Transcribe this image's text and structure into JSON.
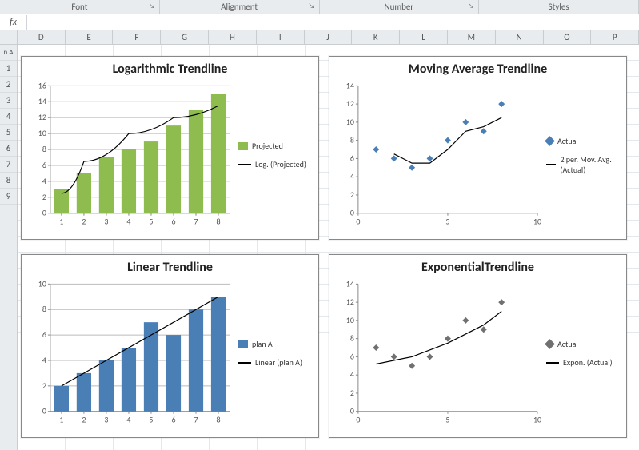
{
  "ribbon": {
    "groups": [
      "Font",
      "Alignment",
      "Number",
      "Styles"
    ]
  },
  "formula_bar": {
    "fx_label": "fx",
    "value": ""
  },
  "columns": [
    "D",
    "E",
    "F",
    "G",
    "H",
    "I",
    "J",
    "K",
    "L",
    "M",
    "N",
    "O",
    "P"
  ],
  "rows_visible": [
    "1",
    "2",
    "3",
    "4",
    "5",
    "6",
    "7",
    "8",
    "9"
  ],
  "rows_partial_label": "n A",
  "charts": {
    "log": {
      "title": "Logarithmic Trendline",
      "legend": [
        "Projected",
        "Log. (Projected)"
      ]
    },
    "mavg": {
      "title": "Moving Average Trendline",
      "legend": [
        "Actual",
        "2 per. Mov. Avg. (Actual)"
      ]
    },
    "linear": {
      "title": "Linear Trendline",
      "legend": [
        "plan A",
        "Linear (plan A)"
      ]
    },
    "exp": {
      "title": "ExponentialTrendline",
      "legend": [
        "Actual",
        "Expon. (Actual)"
      ]
    }
  },
  "chart_data": [
    {
      "type": "bar",
      "title": "Logarithmic Trendline",
      "categories": [
        1,
        2,
        3,
        4,
        5,
        6,
        7,
        8
      ],
      "series": [
        {
          "name": "Projected",
          "values": [
            3,
            5,
            7,
            8,
            9,
            11,
            13,
            15
          ]
        }
      ],
      "trend": {
        "type": "log",
        "name": "Log. (Projected)",
        "points": [
          [
            1,
            2.5
          ],
          [
            2,
            6.5
          ],
          [
            4,
            10
          ],
          [
            6,
            12
          ],
          [
            8,
            13.5
          ]
        ]
      },
      "ylim": [
        0,
        16
      ],
      "ytick": 2,
      "xlabel": "",
      "ylabel": ""
    },
    {
      "type": "scatter",
      "title": "Moving Average Trendline",
      "x": [
        1,
        2,
        3,
        4,
        5,
        6,
        7,
        8
      ],
      "series": [
        {
          "name": "Actual",
          "values": [
            7,
            6,
            5,
            6,
            8,
            10,
            9,
            12
          ]
        }
      ],
      "trend": {
        "type": "moving_avg",
        "period": 2,
        "name": "2 per. Mov. Avg. (Actual)",
        "points": [
          [
            2,
            6.5
          ],
          [
            3,
            5.5
          ],
          [
            4,
            5.5
          ],
          [
            5,
            7
          ],
          [
            6,
            9
          ],
          [
            7,
            9.5
          ],
          [
            8,
            10.5
          ]
        ]
      },
      "xlim": [
        0,
        10
      ],
      "xtick": 5,
      "ylim": [
        0,
        14
      ],
      "ytick": 2
    },
    {
      "type": "bar",
      "title": "Linear Trendline",
      "categories": [
        1,
        2,
        3,
        4,
        5,
        6,
        7,
        8
      ],
      "series": [
        {
          "name": "plan A",
          "values": [
            2,
            3,
            4,
            5,
            7,
            6,
            8,
            9
          ]
        }
      ],
      "trend": {
        "type": "linear",
        "name": "Linear (plan A)",
        "points": [
          [
            1,
            2
          ],
          [
            8,
            9
          ]
        ]
      },
      "ylim": [
        0,
        10
      ],
      "ytick": 2
    },
    {
      "type": "scatter",
      "title": "ExponentialTrendline",
      "x": [
        1,
        2,
        3,
        4,
        5,
        6,
        7,
        8
      ],
      "series": [
        {
          "name": "Actual",
          "values": [
            7,
            6,
            5,
            6,
            8,
            10,
            9,
            12
          ]
        }
      ],
      "trend": {
        "type": "exponential",
        "name": "Expon. (Actual)",
        "points": [
          [
            1,
            5.2
          ],
          [
            3,
            6
          ],
          [
            5,
            7.5
          ],
          [
            7,
            9.5
          ],
          [
            8,
            11
          ]
        ]
      },
      "xlim": [
        0,
        10
      ],
      "xtick": 5,
      "ylim": [
        0,
        14
      ],
      "ytick": 2
    }
  ]
}
